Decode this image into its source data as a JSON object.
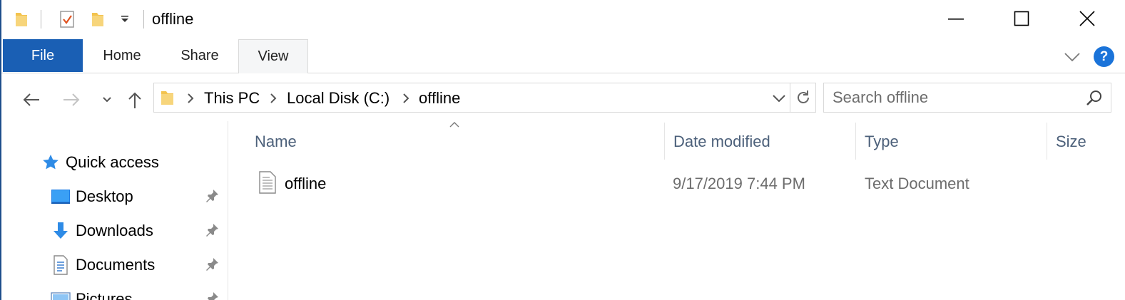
{
  "window": {
    "title": "offline",
    "minimize_icon": "minimize-icon",
    "maximize_icon": "maximize-icon",
    "close_icon": "close-icon"
  },
  "quick_access_toolbar": {
    "icons": [
      "folder-icon",
      "properties-icon",
      "new-folder-icon",
      "customize-dropdown-icon"
    ]
  },
  "ribbon": {
    "tabs": [
      {
        "label": "File"
      },
      {
        "label": "Home"
      },
      {
        "label": "Share"
      },
      {
        "label": "View"
      }
    ],
    "help_label": "?"
  },
  "navigation": {
    "breadcrumb": [
      "This PC",
      "Local Disk (C:)",
      "offline"
    ],
    "search_placeholder": "Search offline"
  },
  "nav_pane": {
    "items": [
      {
        "label": "Quick access",
        "icon": "star-icon",
        "pinned": false
      },
      {
        "label": "Desktop",
        "icon": "desktop-icon",
        "pinned": true
      },
      {
        "label": "Downloads",
        "icon": "downloads-icon",
        "pinned": true
      },
      {
        "label": "Documents",
        "icon": "documents-icon",
        "pinned": true
      },
      {
        "label": "Pictures",
        "icon": "pictures-icon",
        "pinned": true
      }
    ]
  },
  "file_list": {
    "columns": [
      "Name",
      "Date modified",
      "Type",
      "Size"
    ],
    "rows": [
      {
        "name": "offline",
        "date_modified": "9/17/2019 7:44 PM",
        "type": "Text Document",
        "size": "",
        "icon": "text-file-icon"
      }
    ]
  },
  "colors": {
    "accent": "#1a5fb4",
    "help": "#1a73d9",
    "column_header": "#4c607a",
    "secondary_text": "#6d6d6d",
    "folder": "#f3c34e"
  }
}
